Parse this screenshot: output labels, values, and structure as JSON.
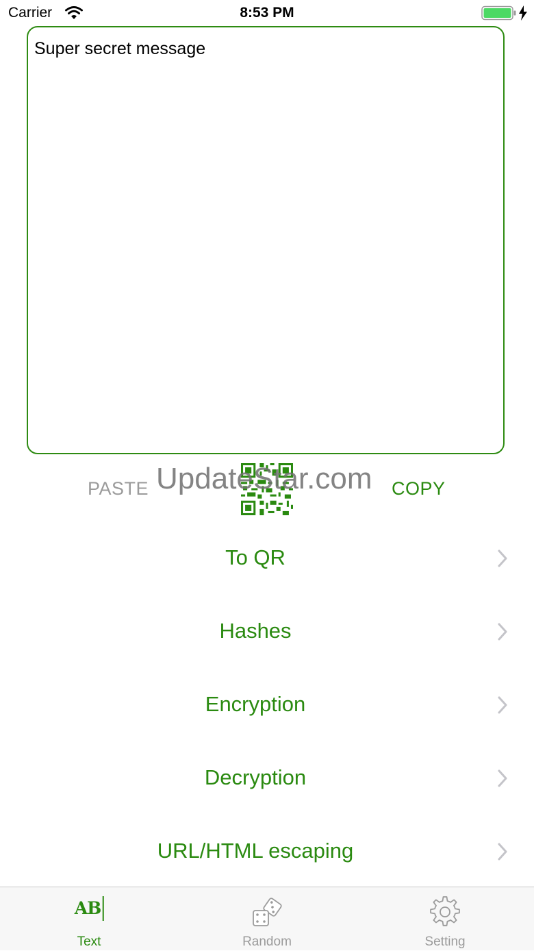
{
  "status_bar": {
    "carrier": "Carrier",
    "time": "8:53 PM"
  },
  "text_area": {
    "value": "Super secret message"
  },
  "actions": {
    "paste_label": "PASTE",
    "copy_label": "COPY",
    "qr_icon": "qr-code-icon"
  },
  "watermark": "UpdateStar.com",
  "menu": {
    "items": [
      {
        "label": "To QR"
      },
      {
        "label": "Hashes"
      },
      {
        "label": "Encryption"
      },
      {
        "label": "Decryption"
      },
      {
        "label": "URL/HTML escaping"
      }
    ]
  },
  "tabs": [
    {
      "label": "Text",
      "icon": "ab-text-icon",
      "selected": true
    },
    {
      "label": "Random",
      "icon": "dice-icon",
      "selected": false
    },
    {
      "label": "Setting",
      "icon": "gear-icon",
      "selected": false
    }
  ],
  "colors": {
    "accent": "#2a8a10",
    "border": "#2e8b12",
    "inactive": "#9b9b9b",
    "battery": "#4cd964"
  }
}
